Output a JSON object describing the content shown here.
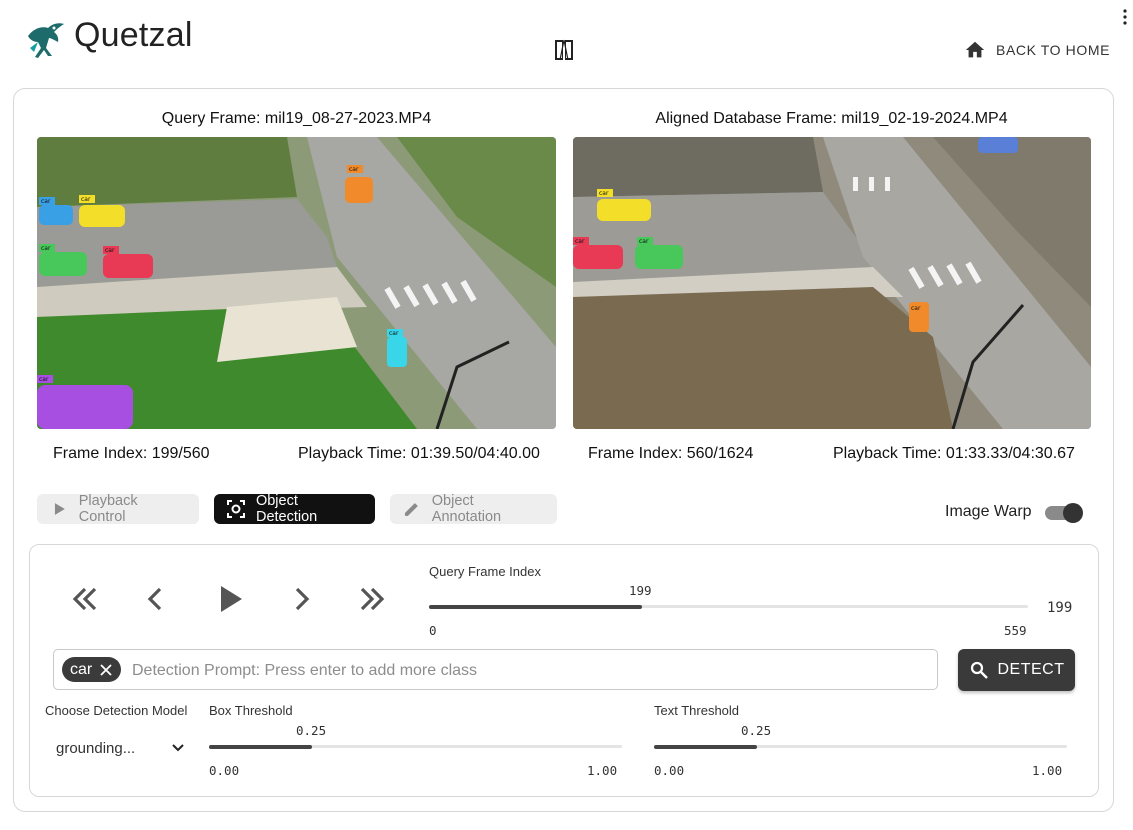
{
  "header": {
    "app_title": "Quetzal",
    "home_label": "BACK TO HOME",
    "icons": {
      "logo": "quetzal-bird-logo",
      "swap": "swap-frames-icon",
      "home": "home-icon",
      "more": "more-vert-icon"
    }
  },
  "query": {
    "title": "Query Frame: mil19_08-27-2023.MP4",
    "frame_index": "Frame Index: 199/560",
    "playback_time": "Playback Time: 01:39.50/04:40.00",
    "detections": [
      "car",
      "car",
      "car",
      "car",
      "car",
      "car",
      "car"
    ]
  },
  "database": {
    "title": "Aligned Database Frame: mil19_02-19-2024.MP4",
    "frame_index": "Frame Index: 560/1624",
    "playback_time": "Playback Time: 01:33.33/04:30.67",
    "detections": [
      "car",
      "car",
      "car",
      "car"
    ]
  },
  "modes": {
    "playback": "Playback Control",
    "detection": "Object Detection",
    "annotation": "Object Annotation",
    "active": "Object Detection"
  },
  "image_warp": {
    "label": "Image Warp",
    "enabled": true
  },
  "frame_slider": {
    "label": "Query Frame Index",
    "value": "199",
    "min": "0",
    "max": "559",
    "value_display": "199",
    "fraction": 0.356
  },
  "prompt": {
    "chip": "car",
    "placeholder": "Detection Prompt: Press enter to add more class"
  },
  "detect_button": "DETECT",
  "model": {
    "label": "Choose Detection Model",
    "selected": "grounding..."
  },
  "box_threshold": {
    "label": "Box Threshold",
    "value": "0.25",
    "min": "0.00",
    "max": "1.00",
    "fraction": 0.25
  },
  "text_threshold": {
    "label": "Text Threshold",
    "value": "0.25",
    "min": "0.00",
    "max": "1.00",
    "fraction": 0.25
  },
  "colors": {
    "accent": "#111111",
    "detect": "#3a3a3a",
    "car_blue": "#3aa0e6",
    "car_yellow": "#f3df2a",
    "car_green": "#48c85a",
    "car_red": "#e83a55",
    "car_orange": "#f08a2a",
    "car_cyan": "#38d6e8",
    "car_purple": "#a64fe0"
  }
}
